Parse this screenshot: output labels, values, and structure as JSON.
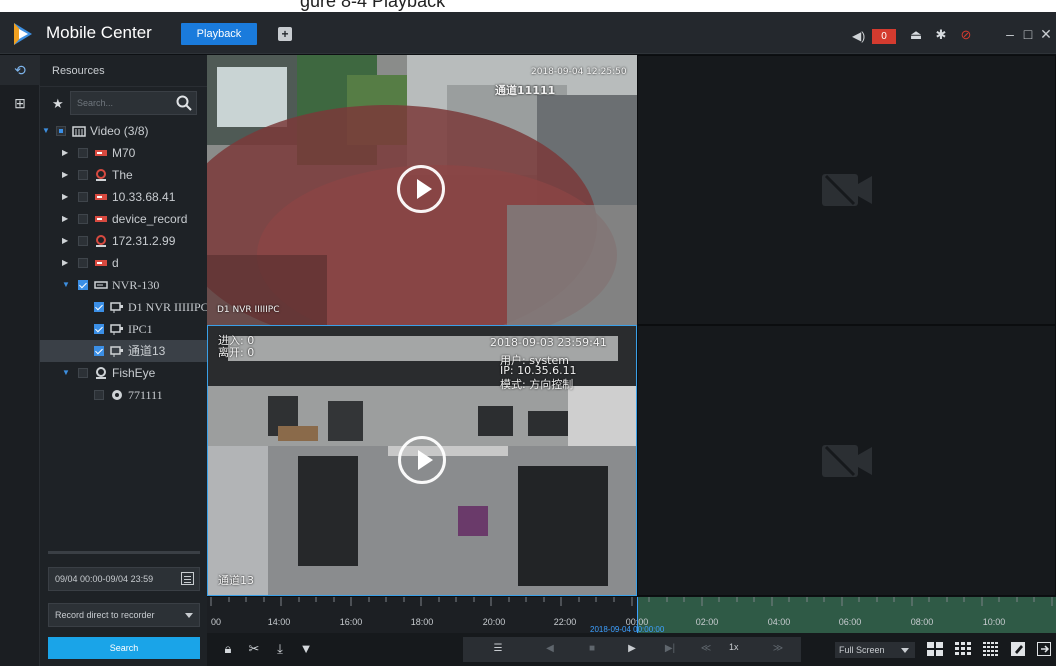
{
  "caption": {
    "text": "gure 8-4 Playback"
  },
  "app": {
    "title": "Mobile Center"
  },
  "tabs": {
    "playback": "Playback"
  },
  "header": {
    "alarm_count": "0"
  },
  "rail": {
    "resources_label": "Resources"
  },
  "search": {
    "placeholder": "Search..."
  },
  "tree": {
    "root": "Video (3/8)",
    "items": [
      {
        "label": "M70"
      },
      {
        "label": "The"
      },
      {
        "label": "10.33.68.41"
      },
      {
        "label": "device_record"
      },
      {
        "label": "172.31.2.99"
      },
      {
        "label": "d"
      },
      {
        "label": "NVR-130"
      },
      {
        "label": "D1 NVR IIIIIPC"
      },
      {
        "label": "IPC1"
      },
      {
        "label": "通道13"
      },
      {
        "label": "FishEye"
      },
      {
        "label": "771111"
      }
    ]
  },
  "filters": {
    "time_range": "09/04 00:00-09/04 23:59",
    "record_source": "Record direct to recorder",
    "search_label": "Search"
  },
  "video": {
    "cell1": {
      "osd_time": "2018-09-04 12:25:50",
      "osd_name": "通道11111",
      "caption": "D1 NVR IIIIIPC"
    },
    "cell3": {
      "osd_in": "进入: 0",
      "osd_out": "离开: 0",
      "osd_time": "2018-09-03 23:59:41",
      "osd_user": "用户: system",
      "osd_ip": "IP: 10.35.6.11",
      "osd_mode": "模式: 方向控制",
      "caption": "通道13"
    }
  },
  "timeline": {
    "ticks": [
      "00",
      "14:00",
      "16:00",
      "18:00",
      "20:00",
      "22:00",
      "00:00",
      "02:00",
      "04:00",
      "06:00",
      "08:00",
      "10:00"
    ],
    "current": "2018-09-04 00:00:00"
  },
  "controls": {
    "speed": "1x",
    "fullscreen_label": "Full Screen"
  },
  "colors": {
    "accent": "#1a7bdc",
    "alarm": "#d43b2f",
    "active_border": "#3aa0e8",
    "record_bar": "#2f5a46"
  }
}
